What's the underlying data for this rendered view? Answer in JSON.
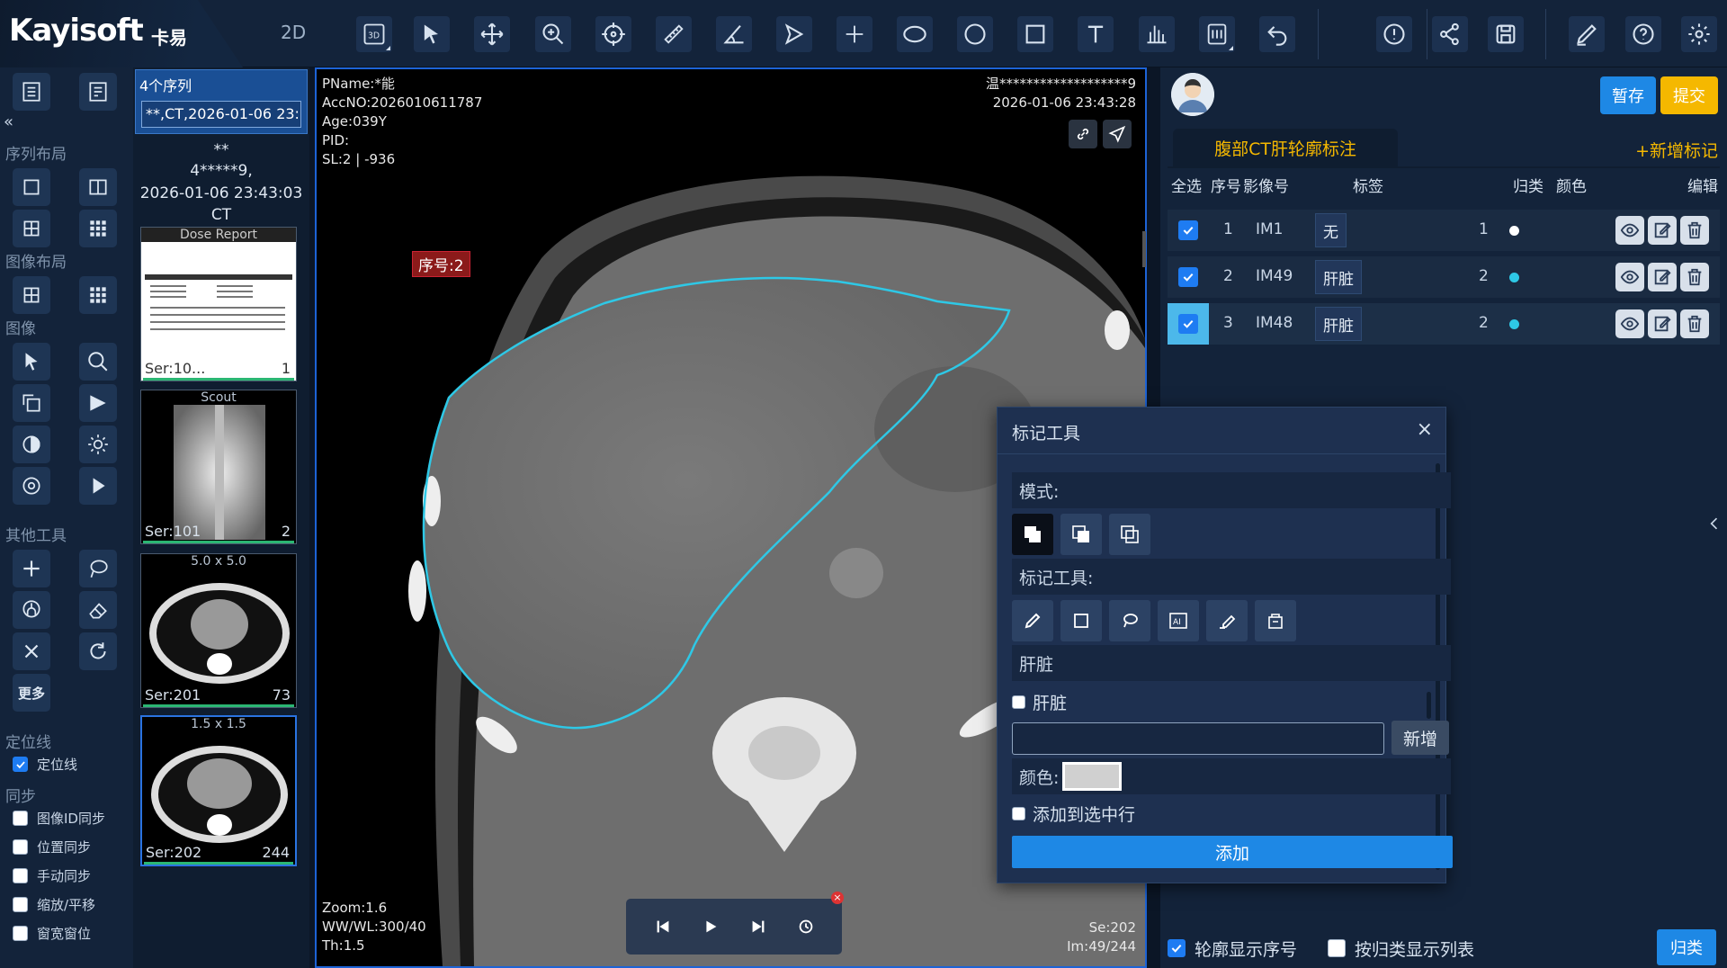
{
  "app": {
    "logo": "Kayisoft",
    "logo_cn": "卡易",
    "mode": "2D"
  },
  "toolbar": {
    "icons": [
      "3d-icon",
      "pointer-icon",
      "move-icon",
      "zoom-icon",
      "crosshair-icon",
      "ruler-icon",
      "angle-icon",
      "polygon-icon",
      "plus-point-icon",
      "ellipse-icon",
      "circle-icon",
      "rectangle-icon",
      "text-icon",
      "histogram-icon",
      "calculator-icon",
      "undo-icon",
      "info-icon",
      "share-icon",
      "save-icon",
      "annotate-icon",
      "help-icon",
      "settings-icon"
    ]
  },
  "left": {
    "sections": {
      "series_layout": "序列布局",
      "image_layout": "图像布局",
      "image": "图像",
      "other_tools": "其他工具",
      "locator": "定位线",
      "sync": "同步"
    },
    "more": "更多",
    "locator_checks": [
      {
        "label": "定位线",
        "checked": true
      }
    ],
    "sync_checks": [
      {
        "label": "图像ID同步",
        "checked": false
      },
      {
        "label": "位置同步",
        "checked": false
      },
      {
        "label": "手动同步",
        "checked": false
      },
      {
        "label": "缩放/平移",
        "checked": false
      },
      {
        "label": "窗宽窗位",
        "checked": false
      }
    ]
  },
  "series": {
    "count_label": "4个序列",
    "study": "**,CT,2026-01-06 23:",
    "patient": "**",
    "id": "4*****9,",
    "datetime": "2026-01-06 23:43:03",
    "modality": "CT",
    "thumbs": [
      {
        "title": "Dose Report",
        "ser": "Ser:10...",
        "count": "1"
      },
      {
        "title": "Scout",
        "ser": "Ser:101",
        "count": "2"
      },
      {
        "title": "5.0 x 5.0",
        "ser": "Ser:201",
        "count": "73"
      },
      {
        "title": "1.5 x 1.5",
        "ser": "Ser:202",
        "count": "244"
      }
    ]
  },
  "viewer": {
    "pname": "PName:*能",
    "accno": "AccNO:2026010611787",
    "age": "Age:039Y",
    "pid": "PID:",
    "sl": "SL:2 | -936",
    "hospital": "温*******************9",
    "date": "2026-01-06 23:43:28",
    "seq_label": "序号:2",
    "zoom": "Zoom:1.6",
    "wwwl": "WW/WL:300/40",
    "th": "Th:1.5",
    "se": "Se:202",
    "im": "Im:49/244"
  },
  "right": {
    "save": "暂存",
    "submit": "提交",
    "tab": "腹部CT肝轮廓标注",
    "add_mark": "+新增标记",
    "headers": {
      "all": "全选",
      "num": "序号",
      "image": "影像号",
      "tag": "标签",
      "class": "归类",
      "color": "颜色",
      "edit": "编辑"
    },
    "rows": [
      {
        "num": "1",
        "image": "IM1",
        "tag": "无",
        "cls": "1",
        "color": "#ffffff"
      },
      {
        "num": "2",
        "image": "IM49",
        "tag": "肝脏",
        "cls": "2",
        "color": "#2ec8e6"
      },
      {
        "num": "3",
        "image": "IM48",
        "tag": "肝脏",
        "cls": "2",
        "color": "#2ec8e6"
      }
    ],
    "bottom": {
      "show_seq": "轮廓显示序号",
      "by_class": "按归类显示列表",
      "group": "归类"
    }
  },
  "dialog": {
    "title": "标记工具",
    "mode": "模式:",
    "tools": "标记工具:",
    "label_field": "肝脏",
    "liver_check": "肝脏",
    "new": "新增",
    "color": "颜色:",
    "add_to_selected": "添加到选中行",
    "add": "添加"
  }
}
